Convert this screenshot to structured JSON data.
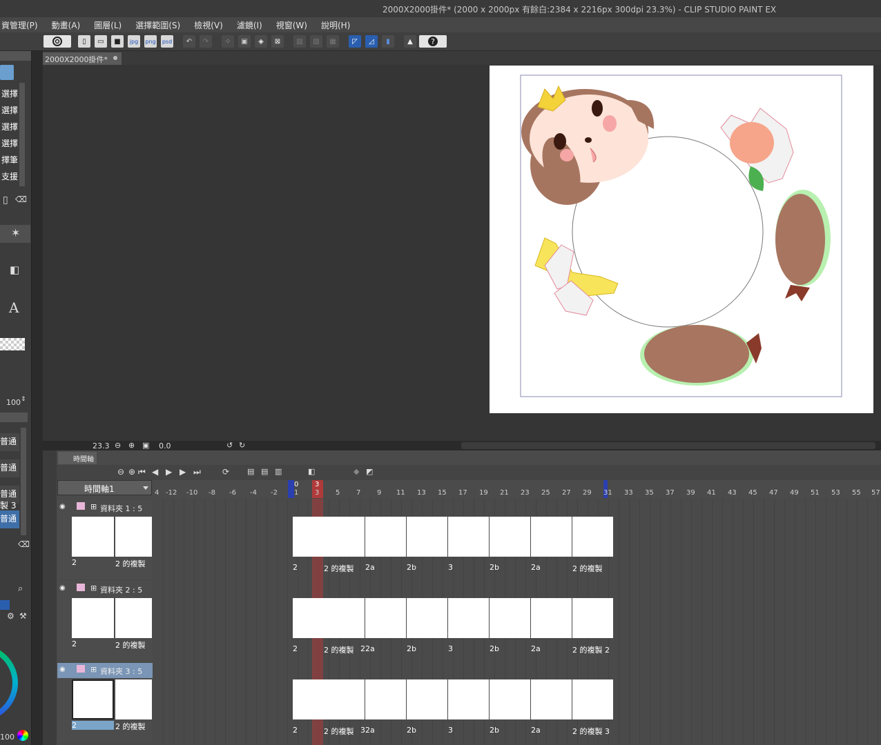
{
  "window": {
    "title": "2000X2000掛件* (2000 x 2000px 有餘白:2384 x 2216px 300dpi 23.3%)  - CLIP STUDIO PAINT EX"
  },
  "menu": {
    "items": [
      "資管理(P)",
      "動畫(A)",
      "圖層(L)",
      "選擇範圍(S)",
      "檢視(V)",
      "濾鏡(I)",
      "視窗(W)",
      "說明(H)"
    ]
  },
  "left_panel": {
    "items": [
      "選擇",
      "選擇",
      "選擇",
      "選擇",
      "擇筆",
      "支援"
    ],
    "opacity_value": "100",
    "layers": [
      "普通",
      "普通",
      "普通",
      "製 3",
      "普通"
    ],
    "color_value": "100"
  },
  "document": {
    "tab_label": "2000X2000掛件*"
  },
  "canvas_status": {
    "zoom": "23.3",
    "rotation": "0.0"
  },
  "timeline": {
    "tab_label": "時間軸",
    "timeline_name": "時間軸1",
    "ruler_ticks": [
      "4",
      "-12",
      "-10",
      "-8",
      "-6",
      "-4",
      "-2",
      "1",
      "3",
      "5",
      "7",
      "9",
      "11",
      "13",
      "15",
      "17",
      "19",
      "21",
      "23",
      "25",
      "27",
      "29",
      "31",
      "33",
      "35",
      "37",
      "39",
      "41",
      "43",
      "45",
      "47",
      "49",
      "51",
      "53",
      "55",
      "57"
    ],
    "start_marker": "0",
    "current_frame": "3",
    "tracks": [
      {
        "name": "資料夾 1 : 5",
        "thumb_labels": [
          "2",
          "2 的複製"
        ],
        "cel_labels": [
          "2",
          "2 的複製",
          "2a",
          "2b",
          "3",
          "2b",
          "2a",
          "2 的複製"
        ]
      },
      {
        "name": "資料夾 2 : 5",
        "thumb_labels": [
          "2",
          "2 的複製"
        ],
        "cel_labels": [
          "2",
          "2 的複製",
          "22a",
          "2b",
          "3",
          "2b",
          "2a",
          "2 的複製 2"
        ]
      },
      {
        "name": "資料夾 3 : 5",
        "thumb_labels": [
          "2",
          "2 的複製"
        ],
        "cel_labels": [
          "2",
          "2 的複製",
          "32a",
          "2b",
          "3",
          "2b",
          "2a",
          "2 的複製 3"
        ]
      }
    ]
  },
  "colors": {
    "accent_blue": "#2a3fb0",
    "playhead_red": "#b03a3a",
    "skin": "#fde3d8",
    "hair": "#a0705a",
    "peach": "#f6a58a",
    "banana": "#f7e45a",
    "kiwi": "#a87560",
    "leaf": "#4caf50"
  }
}
